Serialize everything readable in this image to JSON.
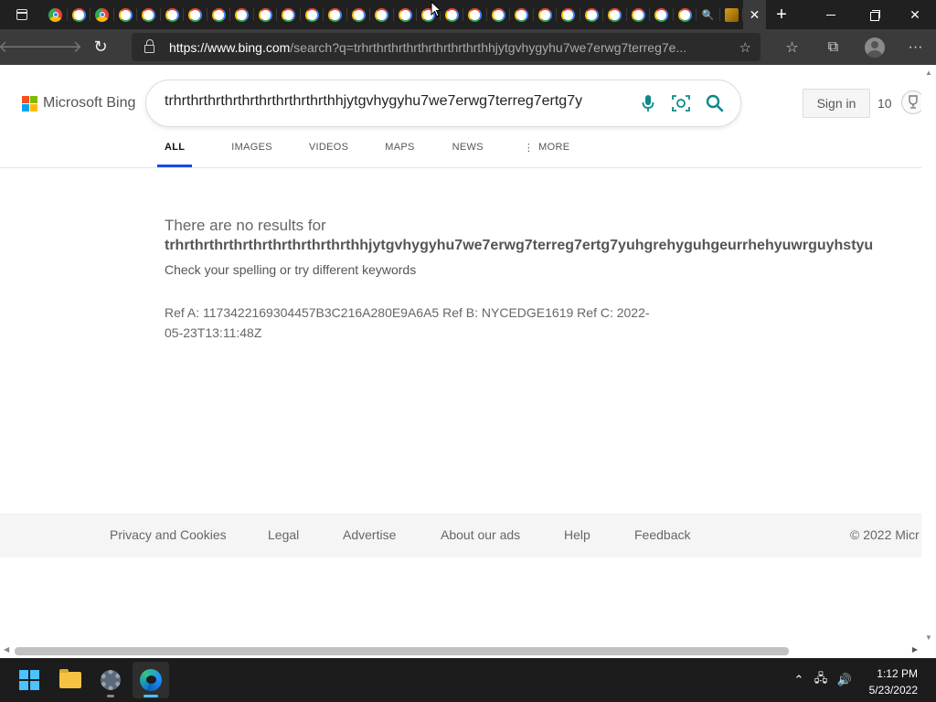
{
  "browser": {
    "tab_count_google": 27,
    "active_tab_close": "✕",
    "new_tab": "+",
    "url_host": "https://www.bing.com",
    "url_rest": "/search?q=trhrthrthrthrthrthrthrthrthhjytgvhygyhu7we7erwg7terreg7e..."
  },
  "header": {
    "logo_text": "Microsoft Bing",
    "search_value": "trhrthrthrthrthrthrthrthrthrthhjytgvhygyhu7we7erwg7terreg7ertg7y",
    "signin_label": "Sign in",
    "rewards_points": "10"
  },
  "scopes": [
    {
      "label": "ALL"
    },
    {
      "label": "IMAGES"
    },
    {
      "label": "VIDEOS"
    },
    {
      "label": "MAPS"
    },
    {
      "label": "NEWS"
    },
    {
      "label": "MORE"
    }
  ],
  "results": {
    "title": "There are no results for",
    "query": "trhrthrthrthrthrthrthrthrthrthhjytgvhygyhu7we7erwg7terreg7ertg7yuhgrehyguhgeurrhehyuwrguyhstyu",
    "hint": "Check your spelling or try different keywords",
    "ref": "Ref A: 1173422169304457B3C216A280E9A6A5 Ref B: NYCEDGE1619 Ref C: 2022-05-23T13:11:48Z"
  },
  "footer": {
    "links": [
      {
        "label": "Privacy and Cookies"
      },
      {
        "label": "Legal"
      },
      {
        "label": "Advertise"
      },
      {
        "label": "About our ads"
      },
      {
        "label": "Help"
      },
      {
        "label": "Feedback"
      },
      {
        "label": "© 2022 Micr"
      }
    ]
  },
  "taskbar": {
    "time": "1:12 PM",
    "date": "5/23/2022"
  },
  "colors": {
    "accent": "#174ae4",
    "bing_teal": "#0a8a8a",
    "taskbar": "#1c1c1c"
  }
}
